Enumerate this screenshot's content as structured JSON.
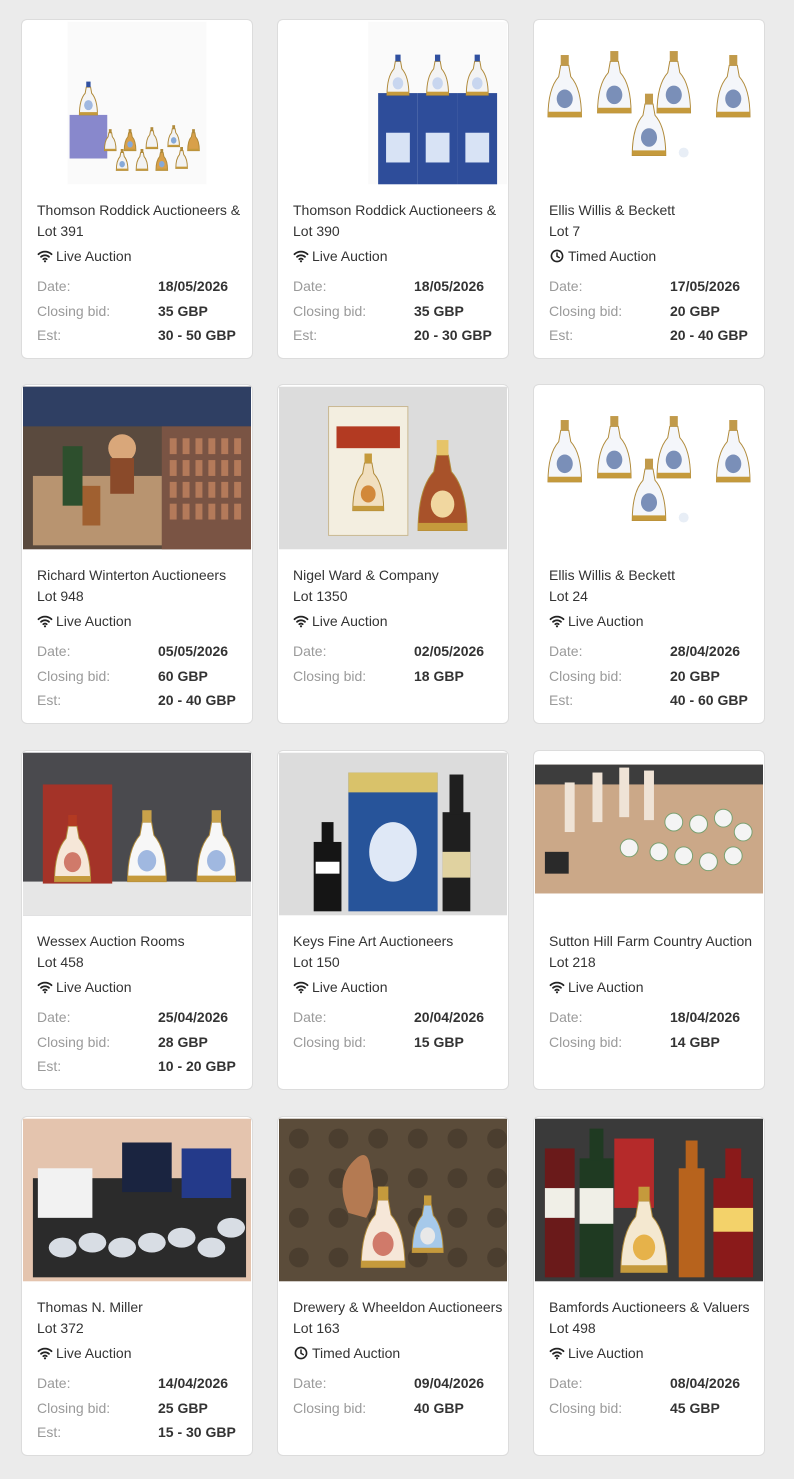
{
  "labels": {
    "date": "Date:",
    "closing_bid": "Closing bid:",
    "estimate": "Est:"
  },
  "lots": [
    {
      "auctioneer": "Thomson Roddick Auctioneers &",
      "lot": "Lot 391",
      "type": "Live Auction",
      "type_icon": "wifi-icon",
      "date": "18/05/2026",
      "closing_bid": "35 GBP",
      "estimate": "30 - 50 GBP",
      "image": "bell-decanters-with-boxed-set"
    },
    {
      "auctioneer": "Thomson Roddick Auctioneers &",
      "lot": "Lot 390",
      "type": "Live Auction",
      "type_icon": "wifi-icon",
      "date": "18/05/2026",
      "closing_bid": "35 GBP",
      "estimate": "20 - 30 GBP",
      "image": "three-bell-decanters-in-blue-tins"
    },
    {
      "auctioneer": "Ellis Willis & Beckett",
      "lot": "Lot 7",
      "type": "Timed Auction",
      "type_icon": "clock-icon",
      "date": "17/05/2026",
      "closing_bid": "20 GBP",
      "estimate": "20 - 40 GBP",
      "image": "five-white-commemorative-bell-decanters"
    },
    {
      "auctioneer": "Richard Winterton Auctioneers",
      "lot": "Lot 948",
      "type": "Live Auction",
      "type_icon": "wifi-icon",
      "date": "05/05/2026",
      "closing_bid": "60 GBP",
      "estimate": "20 - 40 GBP",
      "image": "box-of-mixed-collectables-and-chess-pieces"
    },
    {
      "auctioneer": "Nigel Ward & Company",
      "lot": "Lot 1350",
      "type": "Live Auction",
      "type_icon": "wifi-icon",
      "date": "02/05/2026",
      "closing_bid": "18 GBP",
      "image": "boxed-bell-decanter"
    },
    {
      "auctioneer": "Ellis Willis & Beckett",
      "lot": "Lot 24",
      "type": "Live Auction",
      "type_icon": "wifi-icon",
      "date": "28/04/2026",
      "closing_bid": "20 GBP",
      "estimate": "40 - 60 GBP",
      "image": "five-white-commemorative-bell-decanters"
    },
    {
      "auctioneer": "Wessex Auction Rooms",
      "lot": "Lot 458",
      "type": "Live Auction",
      "type_icon": "wifi-icon",
      "date": "25/04/2026",
      "closing_bid": "28 GBP",
      "estimate": "10 - 20 GBP",
      "image": "three-royal-bell-decanters"
    },
    {
      "auctioneer": "Keys Fine Art Auctioneers",
      "lot": "Lot 150",
      "type": "Live Auction",
      "type_icon": "wifi-icon",
      "date": "20/04/2026",
      "closing_bid": "15 GBP",
      "image": "blue-tin-and-champagne"
    },
    {
      "auctioneer": "Sutton Hill Farm Country Auction",
      "lot": "Lot 218",
      "type": "Live Auction",
      "type_icon": "wifi-icon",
      "date": "18/04/2026",
      "closing_bid": "14 GBP",
      "image": "table-of-china-and-figures"
    },
    {
      "auctioneer": "Thomas N. Miller",
      "lot": "Lot 372",
      "type": "Live Auction",
      "type_icon": "wifi-icon",
      "date": "14/04/2026",
      "closing_bid": "25 GBP",
      "estimate": "15 - 30 GBP",
      "image": "tray-of-glassware"
    },
    {
      "auctioneer": "Drewery & Wheeldon Auctioneers",
      "lot": "Lot 163",
      "type": "Timed Auction",
      "type_icon": "clock-icon",
      "date": "09/04/2026",
      "closing_bid": "40 GBP",
      "image": "eagle-and-bell-decanters"
    },
    {
      "auctioneer": "Bamfords Auctioneers & Valuers",
      "lot": "Lot 498",
      "type": "Live Auction",
      "type_icon": "wifi-icon",
      "date": "08/04/2026",
      "closing_bid": "45 GBP",
      "image": "mixed-spirits-bottles"
    }
  ]
}
